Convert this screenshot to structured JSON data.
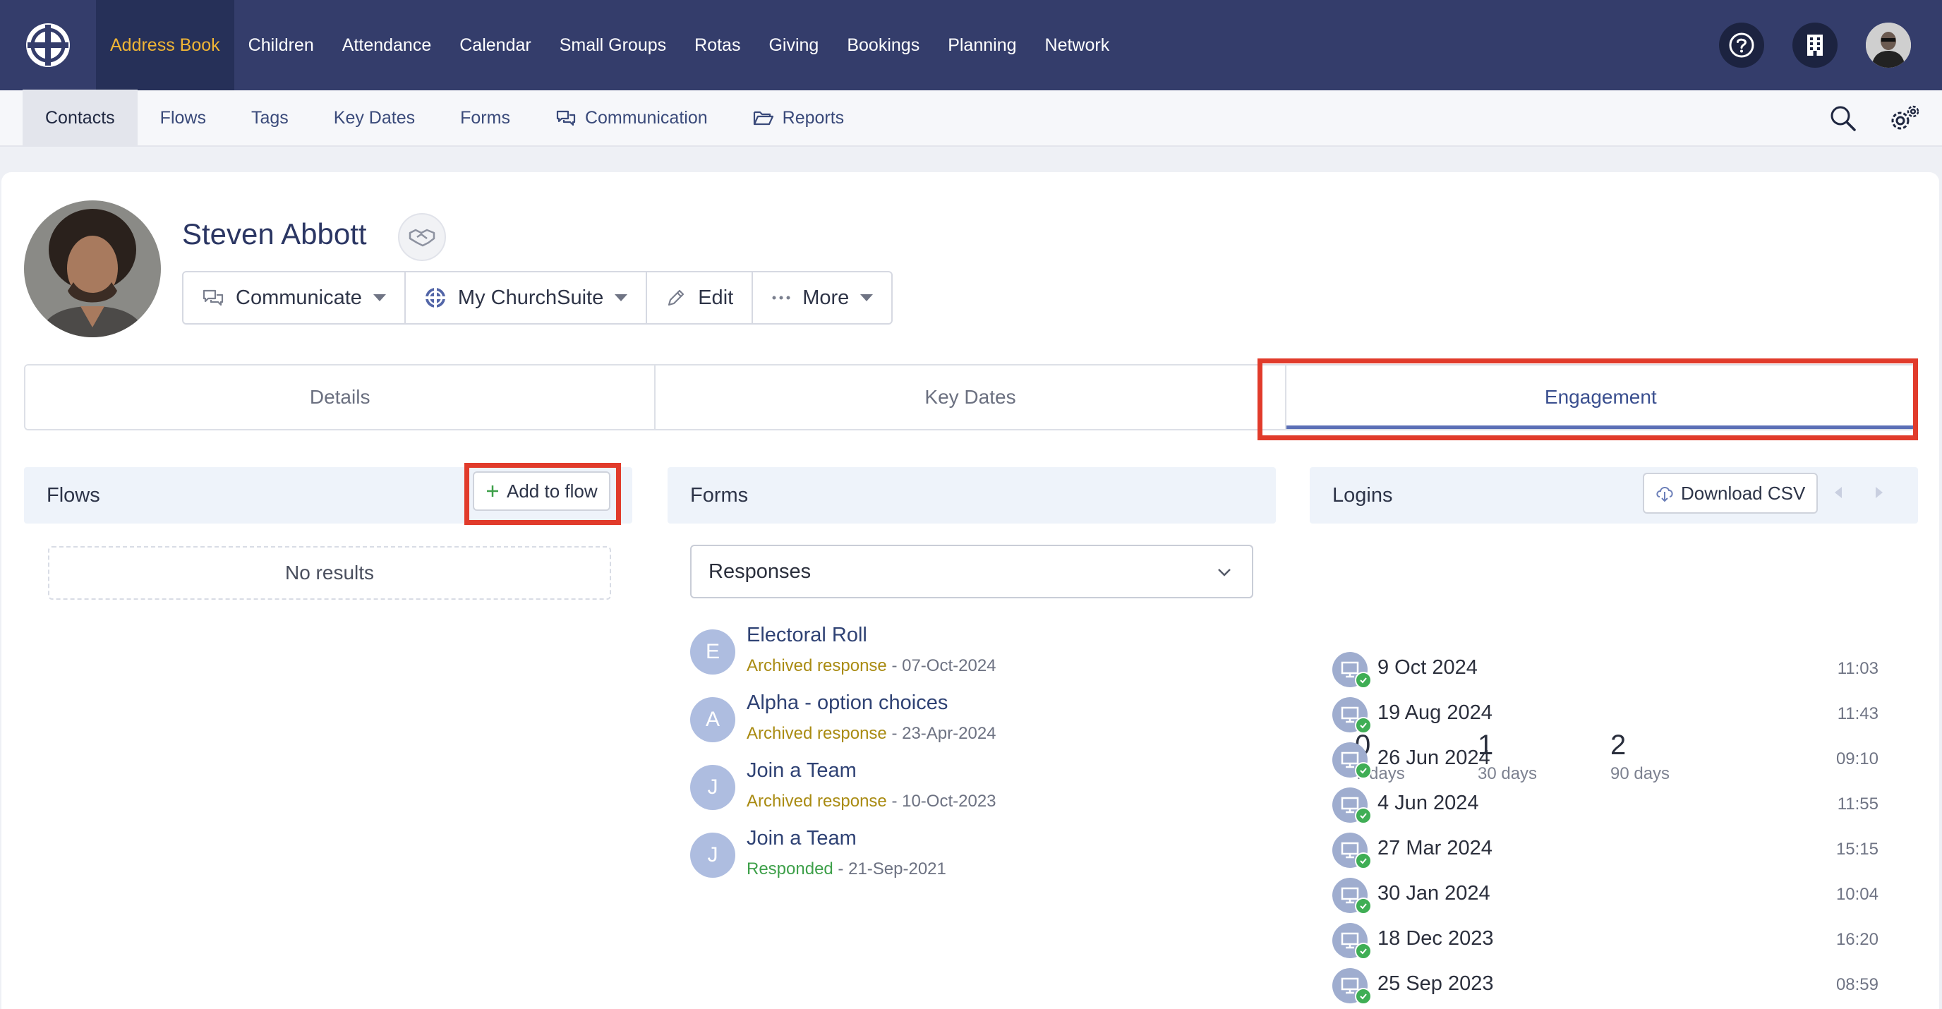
{
  "topnav": {
    "items": [
      {
        "label": "Address Book",
        "active": true
      },
      {
        "label": "Children"
      },
      {
        "label": "Attendance"
      },
      {
        "label": "Calendar"
      },
      {
        "label": "Small Groups"
      },
      {
        "label": "Rotas"
      },
      {
        "label": "Giving"
      },
      {
        "label": "Bookings"
      },
      {
        "label": "Planning"
      },
      {
        "label": "Network"
      }
    ],
    "right_icons": [
      "help-icon",
      "building-icon",
      "user-avatar"
    ],
    "accent": "#f0b535",
    "background": "#343d6b"
  },
  "subnav": {
    "items": [
      {
        "label": "Contacts",
        "active": true
      },
      {
        "label": "Flows"
      },
      {
        "label": "Tags"
      },
      {
        "label": "Key Dates"
      },
      {
        "label": "Forms"
      },
      {
        "label": "Communication",
        "icon": "chat-bubbles-icon"
      },
      {
        "label": "Reports",
        "icon": "folder-open-icon"
      }
    ],
    "right_icons": [
      "search-icon",
      "settings-gears-icon"
    ]
  },
  "profile": {
    "name": "Steven Abbott",
    "actions": {
      "communicate": "Communicate",
      "mychurchsuite": "My ChurchSuite",
      "edit": "Edit",
      "more": "More"
    }
  },
  "tabs": [
    {
      "label": "Details"
    },
    {
      "label": "Key Dates"
    },
    {
      "label": "Engagement",
      "active": true
    }
  ],
  "flows": {
    "title": "Flows",
    "add_label": "Add to flow",
    "empty": "No results"
  },
  "forms": {
    "title": "Forms",
    "select_value": "Responses",
    "items": [
      {
        "initial": "E",
        "title": "Electoral Roll",
        "status": "Archived response",
        "date": " - 07-Oct-2024",
        "kind": "archived"
      },
      {
        "initial": "A",
        "title": "Alpha - option choices",
        "status": "Archived response",
        "date": " - 23-Apr-2024",
        "kind": "archived"
      },
      {
        "initial": "J",
        "title": "Join a Team",
        "status": "Archived response",
        "date": " - 10-Oct-2023",
        "kind": "archived"
      },
      {
        "initial": "J",
        "title": "Join a Team",
        "status": "Responded",
        "date": " - 21-Sep-2021",
        "kind": "responded"
      }
    ]
  },
  "logins": {
    "title": "Logins",
    "download_label": "Download CSV",
    "stats": [
      {
        "value": "0",
        "label": "7 days"
      },
      {
        "value": "1",
        "label": "30 days"
      },
      {
        "value": "2",
        "label": "90 days"
      }
    ],
    "entries": [
      {
        "date": "9 Oct 2024",
        "time": "11:03"
      },
      {
        "date": "19 Aug 2024",
        "time": "11:43"
      },
      {
        "date": "26 Jun 2024",
        "time": "09:10"
      },
      {
        "date": "4 Jun 2024",
        "time": "11:55"
      },
      {
        "date": "27 Mar 2024",
        "time": "15:15"
      },
      {
        "date": "30 Jan 2024",
        "time": "10:04"
      },
      {
        "date": "18 Dec 2023",
        "time": "16:20"
      },
      {
        "date": "25 Sep 2023",
        "time": "08:59"
      }
    ]
  }
}
